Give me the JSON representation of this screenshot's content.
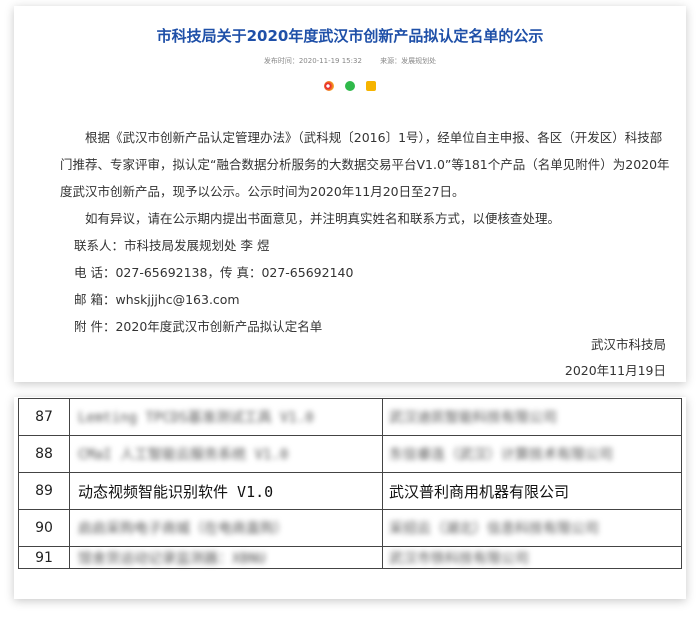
{
  "notice": {
    "title": "市科技局关于2020年度武汉市创新产品拟认定名单的公示",
    "meta_time": "发布时间：2020-11-19 15:32",
    "meta_source": "来源：发展规划处",
    "share_icons": [
      "weibo-icon",
      "wechat-icon",
      "qzone-icon"
    ],
    "para1": "根据《武汉市创新产品认定管理办法》（武科规〔2016〕1号），经单位自主申报、各区（开发区）科技部门推荐、专家评审，拟认定“融合数据分析服务的大数据交易平台V1.0”等181个产品（名单见附件）为2020年度武汉市创新产品，现予以公示。公示时间为2020年11月20日至27日。",
    "para2": "如有异议，请在公示期内提出书面意见，并注明真实姓名和联系方式，以便核查处理。",
    "contact": "联系人：市科技局发展规划处 李 煜",
    "phone": "电 话：027-65692138，传 真：027-65692140",
    "email": "邮 箱：whskjjjhc@163.com",
    "attachment": "附 件：2020年度武汉市创新产品拟认定名单",
    "sign_org": "武汉市科技局",
    "sign_date": "2020年11月19日"
  },
  "table": {
    "rows": [
      {
        "no": "87",
        "product": "Lemting TPCDS基准测试工具 V1.0",
        "company": "武汉迪凯智能科技有限公司",
        "blurred": true
      },
      {
        "no": "88",
        "product": "CMaI 人工智能云服务系统 V1.0",
        "company": "东信睿连（武汉）计算技术有限公司",
        "blurred": true
      },
      {
        "no": "89",
        "product": "动态视频智能识别软件 V1.0",
        "company": "武汉普利商用机器有限公司",
        "blurred": false
      },
      {
        "no": "90",
        "product": "启启采购电子商城（在电商直购）",
        "company": "采招云（湖北）信息科技有限公司",
        "blurred": true
      },
      {
        "no": "91",
        "product": "馆舍货运动记录监测器：XBNU",
        "company": "武汉市铁科技有限公司",
        "blurred": true
      }
    ]
  }
}
